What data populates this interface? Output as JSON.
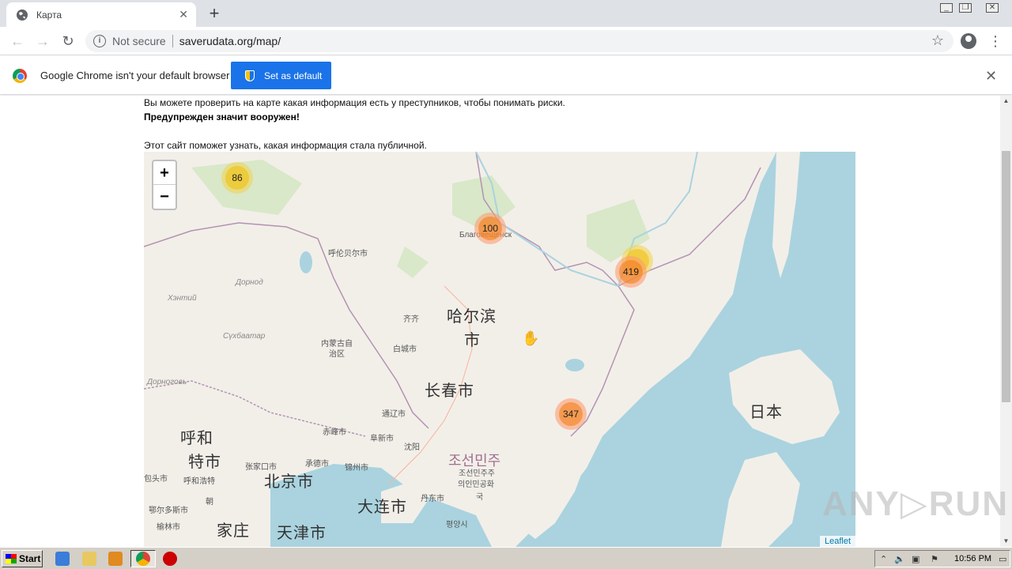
{
  "browser": {
    "tab_title": "Карта",
    "address_not_secure": "Not secure",
    "address_url": "saverudata.org/map/",
    "infobar_message": "Google Chrome isn't your default browser",
    "set_default_label": "Set as default"
  },
  "page": {
    "paragraph1": "Вы можете проверить на карте какая информация есть у преступников, чтобы понимать риски.",
    "paragraph2": "Предупрежден значит вооружен!",
    "paragraph3": "Этот сайт поможет узнать, какая информация стала публичной."
  },
  "map": {
    "zoom_in": "+",
    "zoom_out": "−",
    "attribution": "Leaflet",
    "clusters": [
      {
        "count": "86",
        "color": "yellow"
      },
      {
        "count": "100",
        "color": "orange"
      },
      {
        "count": "419",
        "color": "orange"
      },
      {
        "count": "347",
        "color": "orange"
      }
    ],
    "labels": {
      "blagoveshchensk": "Благовещенск",
      "hulunbuir": "呼伦贝尔市",
      "dornod": "Дорнод",
      "khentii": "Хэнтий",
      "sukhbaatar": "Сүхбаатар",
      "dornogovi": "Дорноговь",
      "harbin1": "哈尔滨",
      "harbin2": "市",
      "qiqihar": "齐齐",
      "neimenggu1": "内蒙古自",
      "neimenggu2": "治区",
      "baicheng": "白城市",
      "changchun": "长春市",
      "tongliao": "通辽市",
      "chifeng": "赤峰市",
      "fuxin": "阜新市",
      "shenyang": "沈阳",
      "huhehaote1": "呼和",
      "huhehaote2": "特市",
      "zhangjiakou": "张家口市",
      "chengde": "承德市",
      "jinzhou": "锦州市",
      "baotou": "包头市",
      "huhehaote_small": "呼和浩特",
      "chaoyang": "朝",
      "beijing": "北京市",
      "dalian": "大连市",
      "dandong": "丹东市",
      "ordos": "鄂尔多斯市",
      "yulin": "榆林市",
      "shijiazhuang": "家庄",
      "tianjin": "天津市",
      "north_korea1": "조선민주",
      "north_korea2": "조선민주주",
      "north_korea3": "의인민공화",
      "north_korea4": "국",
      "pyongyang": "평양시",
      "japan": "日本"
    }
  },
  "watermark": "ANY▷RUN",
  "taskbar": {
    "start_label": "Start",
    "clock": "10:56 PM"
  }
}
